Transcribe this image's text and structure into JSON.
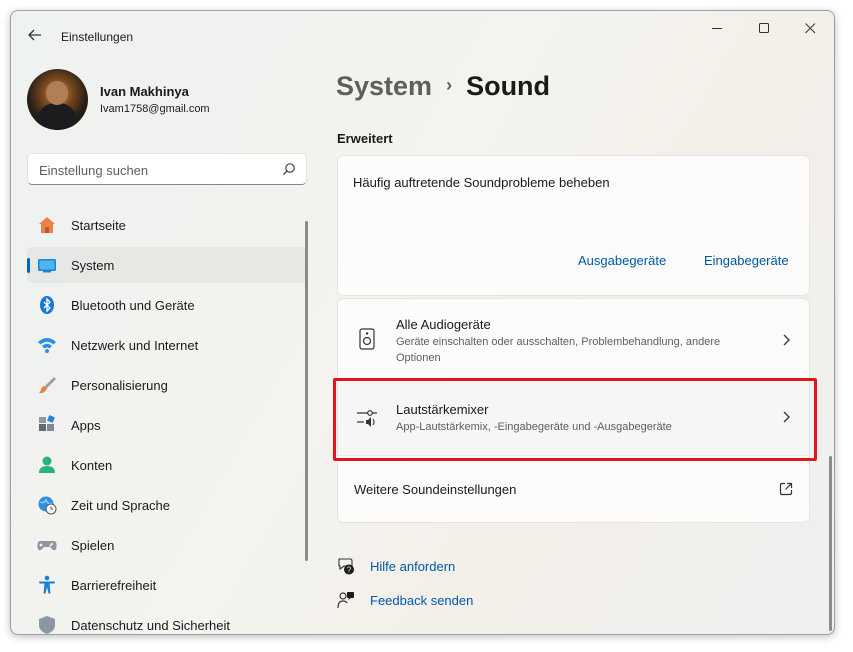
{
  "window": {
    "app_title": "Einstellungen",
    "controls": [
      "minimize-icon",
      "maximize-icon",
      "close-icon"
    ]
  },
  "profile": {
    "name": "Ivan Makhinya",
    "email": "Ivam1758@gmail.com"
  },
  "search": {
    "placeholder": "Einstellung suchen"
  },
  "sidebar": {
    "items": [
      {
        "label": "Startseite",
        "icon": "home-icon"
      },
      {
        "label": "System",
        "icon": "system-icon",
        "active": true
      },
      {
        "label": "Bluetooth und Geräte",
        "icon": "bluetooth-icon"
      },
      {
        "label": "Netzwerk und Internet",
        "icon": "wifi-icon"
      },
      {
        "label": "Personalisierung",
        "icon": "brush-icon"
      },
      {
        "label": "Apps",
        "icon": "apps-icon"
      },
      {
        "label": "Konten",
        "icon": "account-icon"
      },
      {
        "label": "Zeit und Sprache",
        "icon": "globe-clock-icon"
      },
      {
        "label": "Spielen",
        "icon": "gamepad-icon"
      },
      {
        "label": "Barrierefreiheit",
        "icon": "accessibility-icon"
      },
      {
        "label": "Datenschutz und Sicherheit",
        "icon": "shield-icon"
      }
    ]
  },
  "main": {
    "breadcrumb": {
      "parent": "System",
      "separator": "›",
      "current": "Sound"
    },
    "section": "Erweitert",
    "troubleshoot": {
      "title": "Häufig auftretende Soundprobleme beheben",
      "output_link": "Ausgabegeräte",
      "input_link": "Eingabegeräte"
    },
    "rows": {
      "audio": {
        "title": "Alle Audiogeräte",
        "desc": "Geräte einschalten oder ausschalten, Problembehandlung, andere Optionen"
      },
      "mixer": {
        "title": "Lautstärkemixer",
        "desc": "App-Lautstärkemix, -Eingabegeräte und -Ausgabegeräte"
      },
      "more": {
        "title": "Weitere Soundeinstellungen"
      }
    },
    "help": {
      "get_help": "Hilfe anfordern",
      "feedback": "Feedback senden"
    }
  },
  "colors": {
    "accent": "#0067c0",
    "link": "#0058a8",
    "highlight": "#e3141b"
  }
}
